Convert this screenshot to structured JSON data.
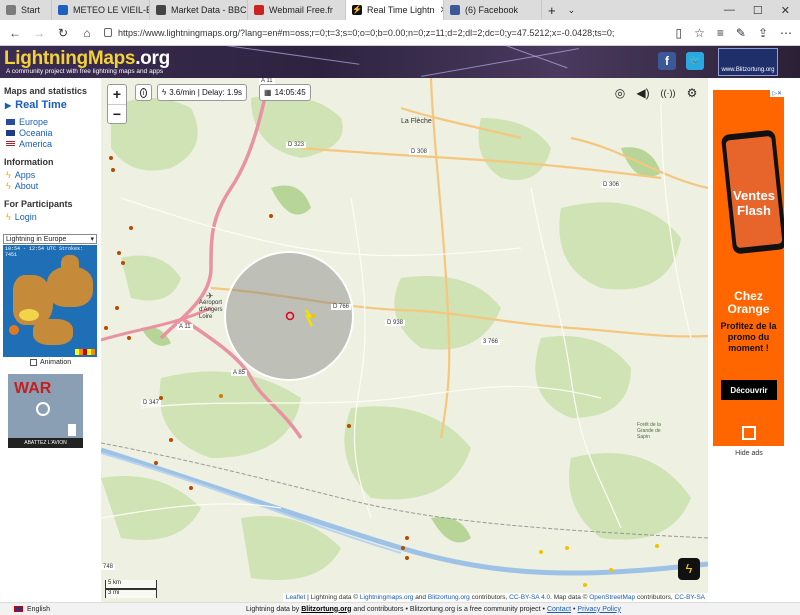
{
  "browser": {
    "tabs": [
      {
        "label": "Start",
        "fav": "#7b7b7b",
        "active": false
      },
      {
        "label": "METEO LE VIEIL-BAU",
        "fav": "#1f5fbf",
        "active": false
      },
      {
        "label": "Market Data - BBC N",
        "fav": "#444444",
        "active": false
      },
      {
        "label": "Webmail Free.fr",
        "fav": "#cc2222",
        "active": false
      },
      {
        "label": "Real Time Lightn",
        "fav": "#111111",
        "active": true
      },
      {
        "label": "(6) Facebook",
        "fav": "#3b5998",
        "active": false
      }
    ],
    "new_tab": "+",
    "url": "https://www.lightningmaps.org/?lang=en#m=oss;r=0;t=3;s=0;o=0;b=0.00;n=0;z=11;d=2;dl=2;dc=0;y=47.5212;x=-0.0428;ts=0;"
  },
  "header": {
    "logo_main": "LightningMaps",
    "logo_tld": ".org",
    "tagline": "A community project with free lightning maps and apps",
    "blitzortung_label": "www.Blitzortung.org"
  },
  "sidebar": {
    "maps_heading": "Maps and statistics",
    "realtime": "Real Time",
    "regions": [
      {
        "label": "Europe",
        "flag": "#2a4aa0"
      },
      {
        "label": "Oceania",
        "flag": "#1f3a8a"
      },
      {
        "label": "America",
        "flag": "#b22234"
      }
    ],
    "info_heading": "Information",
    "info_links": [
      "Apps",
      "About"
    ],
    "participants_heading": "For Participants",
    "login": "Login",
    "select_value": "Lightning in Europe",
    "minimap_caption": "10:54 - 12:54 UTC Strokes: 7451",
    "animation": "Animation",
    "ad_title": "WAR",
    "ad_footer": "ABATTEZ L'AVION"
  },
  "map": {
    "stats": "3.6/min | Delay: 1.9s",
    "time": "14:05:45",
    "towns": [
      "La Flèche",
      "Aéroport d'Angers Loire"
    ],
    "roads": [
      "A 11",
      "D 323",
      "D 308",
      "D 306",
      "D 766",
      "D 938",
      "3 766",
      "A 11",
      "A 85",
      "D 347",
      "748"
    ],
    "scale_km": "5 km",
    "scale_mi": "3 mi",
    "attribution": [
      "Leaflet",
      " | Lightning data © ",
      "Lightningmaps.org",
      " and ",
      "Blitzortung.org",
      " contributors, ",
      "CC-BY-SA 4.0",
      ". Map data © ",
      "OpenStreetMap",
      " contributors, ",
      "CC-BY-SA"
    ],
    "forest_label": "Forêt de la Grande de Sapin"
  },
  "right_ad": {
    "ventes": "Ventes Flash",
    "chez": "Chez Orange",
    "profitez": "Profitez de la promo du moment !",
    "cta": "Découvrir",
    "hide": "Hide ads"
  },
  "footer": {
    "language": "English",
    "credits_prefix": "Lightning data by ",
    "credits_blitz": "Blitzortung.org",
    "credits_mid": " and contributors • Blitzortung.org is a free community project • ",
    "contact": "Contact",
    "sep": " • ",
    "privacy": "Privacy Policy"
  },
  "colors": {
    "accent_yellow": "#f3d13a",
    "link_blue": "#1a5eb8",
    "orange_brand": "#ff6600",
    "strike_recent": "#f2c200",
    "strike_old": "#b84a00"
  }
}
